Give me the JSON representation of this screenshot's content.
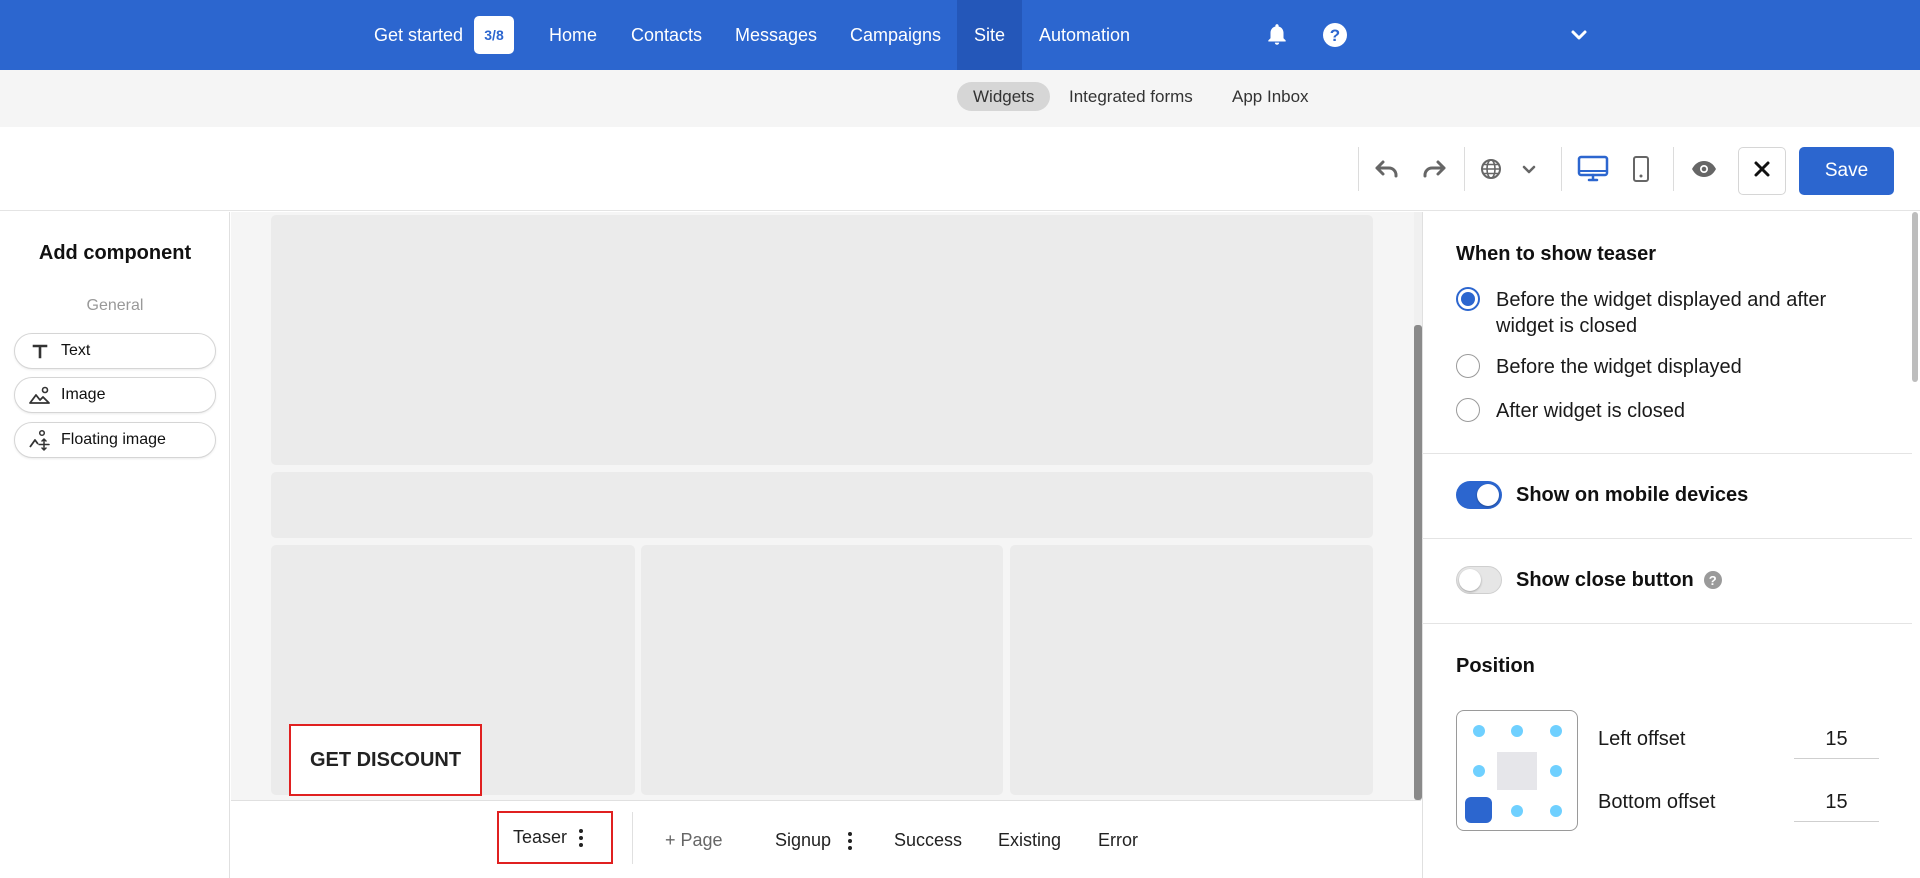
{
  "topnav": {
    "get_started": "Get started",
    "progress_badge": "3/8",
    "items": [
      "Home",
      "Contacts",
      "Messages",
      "Campaigns",
      "Site",
      "Automation"
    ],
    "active_item": "Site",
    "icons": [
      "bell-icon",
      "help-icon",
      "chevron-down-icon"
    ]
  },
  "subnav": {
    "items": [
      "Widgets",
      "Integrated forms",
      "App Inbox"
    ],
    "active_item": "Widgets"
  },
  "toolbar": {
    "icons": [
      "undo-icon",
      "redo-icon",
      "globe-icon",
      "chevron-down-icon",
      "desktop-icon",
      "mobile-icon",
      "eye-icon",
      "close-icon"
    ],
    "active_device": "desktop",
    "save_label": "Save"
  },
  "left_panel": {
    "title": "Add component",
    "section": "General",
    "components": [
      {
        "label": "Text",
        "icon": "text-icon"
      },
      {
        "label": "Image",
        "icon": "image-icon"
      },
      {
        "label": "Floating image",
        "icon": "floating-image-icon"
      }
    ]
  },
  "canvas": {
    "teaser_button": "GET DISCOUNT"
  },
  "bottom_tabs": {
    "teaser": "Teaser",
    "add_page": "Page",
    "signup": "Signup",
    "success": "Success",
    "existing": "Existing",
    "error": "Error"
  },
  "right_panel": {
    "when_to_show": {
      "heading": "When to show teaser",
      "options": [
        {
          "line1": "Before the widget displayed and after",
          "line2": "widget is closed",
          "checked": true
        },
        {
          "line1": "Before the widget displayed",
          "checked": false
        },
        {
          "line1": "After widget is closed",
          "checked": false
        }
      ]
    },
    "show_on_mobile": {
      "label": "Show on mobile devices",
      "enabled": true
    },
    "show_close_button": {
      "label": "Show close button",
      "enabled": false,
      "help": "?"
    },
    "position": {
      "heading": "Position",
      "selected": "bottom-left",
      "left_offset_label": "Left offset",
      "left_offset_value": "15",
      "bottom_offset_label": "Bottom offset",
      "bottom_offset_value": "15"
    }
  },
  "colors": {
    "accent": "#2c66cf",
    "highlight_border": "#e02020",
    "position_dot": "#6fd0ff"
  }
}
